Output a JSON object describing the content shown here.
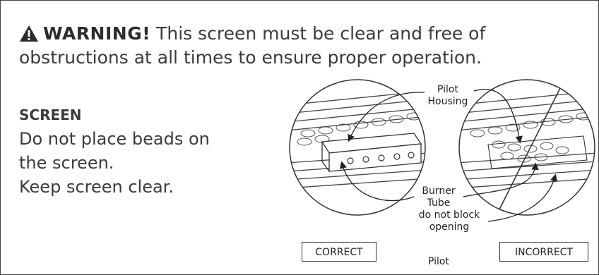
{
  "warning": {
    "title": "WARNING!",
    "line1_rest": "This screen must be clear and free of",
    "line2": "obstructions at all times to ensure proper operation."
  },
  "left_text": {
    "heading": "SCREEN",
    "lines": [
      "Do not place beads on",
      "the screen.",
      "Keep screen clear."
    ]
  },
  "diagram": {
    "pilot_housing": [
      "Pilot",
      "Housing"
    ],
    "burner_tube": [
      "Burner",
      "Tube"
    ],
    "do_not_block": [
      "do not block",
      "opening"
    ],
    "pilot_bottom": "Pilot",
    "correct_label": "CORRECT",
    "incorrect_label": "INCORRECT"
  },
  "icons": [
    "warning-triangle-icon"
  ]
}
